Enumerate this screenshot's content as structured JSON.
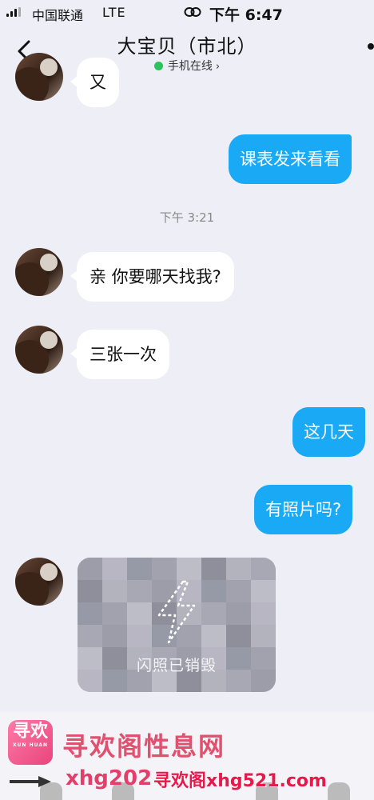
{
  "status_bar": {
    "carrier": "中国联通",
    "network": "LTE",
    "time": "下午 6:47"
  },
  "header": {
    "title": "大宝贝（市北）",
    "status": "手机在线",
    "status_chevron": "›"
  },
  "messages": [
    {
      "from": "contact",
      "text": "又"
    },
    {
      "from": "me",
      "text": "课表发来看看"
    },
    {
      "from": "system",
      "text": "下午 3:21"
    },
    {
      "from": "contact",
      "text": "亲 你要哪天找我?"
    },
    {
      "from": "contact",
      "text": "三张一次"
    },
    {
      "from": "me",
      "text": "这几天"
    },
    {
      "from": "me",
      "text": "有照片吗?"
    },
    {
      "from": "contact",
      "type": "flash-photo",
      "text": "闪照已销毁"
    }
  ],
  "watermark": {
    "logo": "寻欢",
    "logo_sub": "XUN HUAN",
    "title": "寻欢阁性息网",
    "url_left": "xhg202",
    "overlay": "寻欢阁xhg521.com"
  },
  "colors": {
    "background": "#eeeef6",
    "outgoing_bubble": "#19a9f5",
    "incoming_bubble": "#ffffff",
    "online": "#2bc45a",
    "watermark": "#e8194a"
  },
  "icons": [
    "back-arrow-icon",
    "link-icon",
    "lightning-icon",
    "signal-icon"
  ]
}
